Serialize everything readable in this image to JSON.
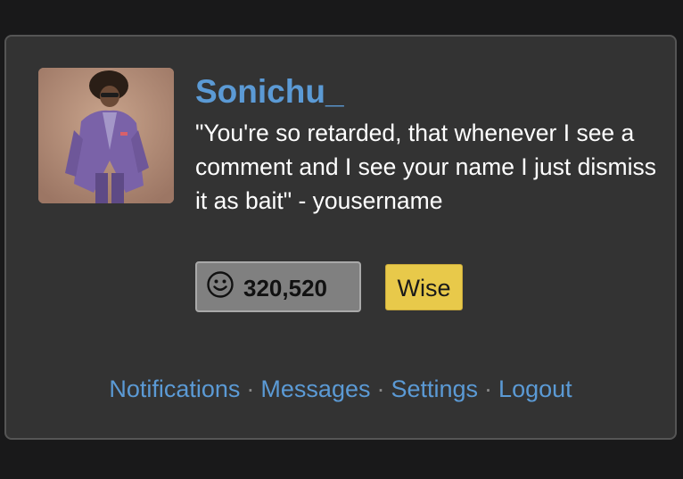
{
  "profile": {
    "username": "Sonichu_",
    "bio": "\"You're so retarded, that whenever I see a comment and I see your name I just dismiss it as bait\" - yousername",
    "score": "320,520",
    "rank": "Wise"
  },
  "nav": {
    "notifications": "Notifications",
    "messages": "Messages",
    "settings": "Settings",
    "logout": "Logout",
    "separator": "·"
  },
  "icons": {
    "score": "smiley-icon"
  },
  "colors": {
    "page_background": "#19191a",
    "card_background": "#333333",
    "link": "#5b9ad5",
    "score_box": "#808080",
    "rank_badge": "#e8c94a"
  }
}
